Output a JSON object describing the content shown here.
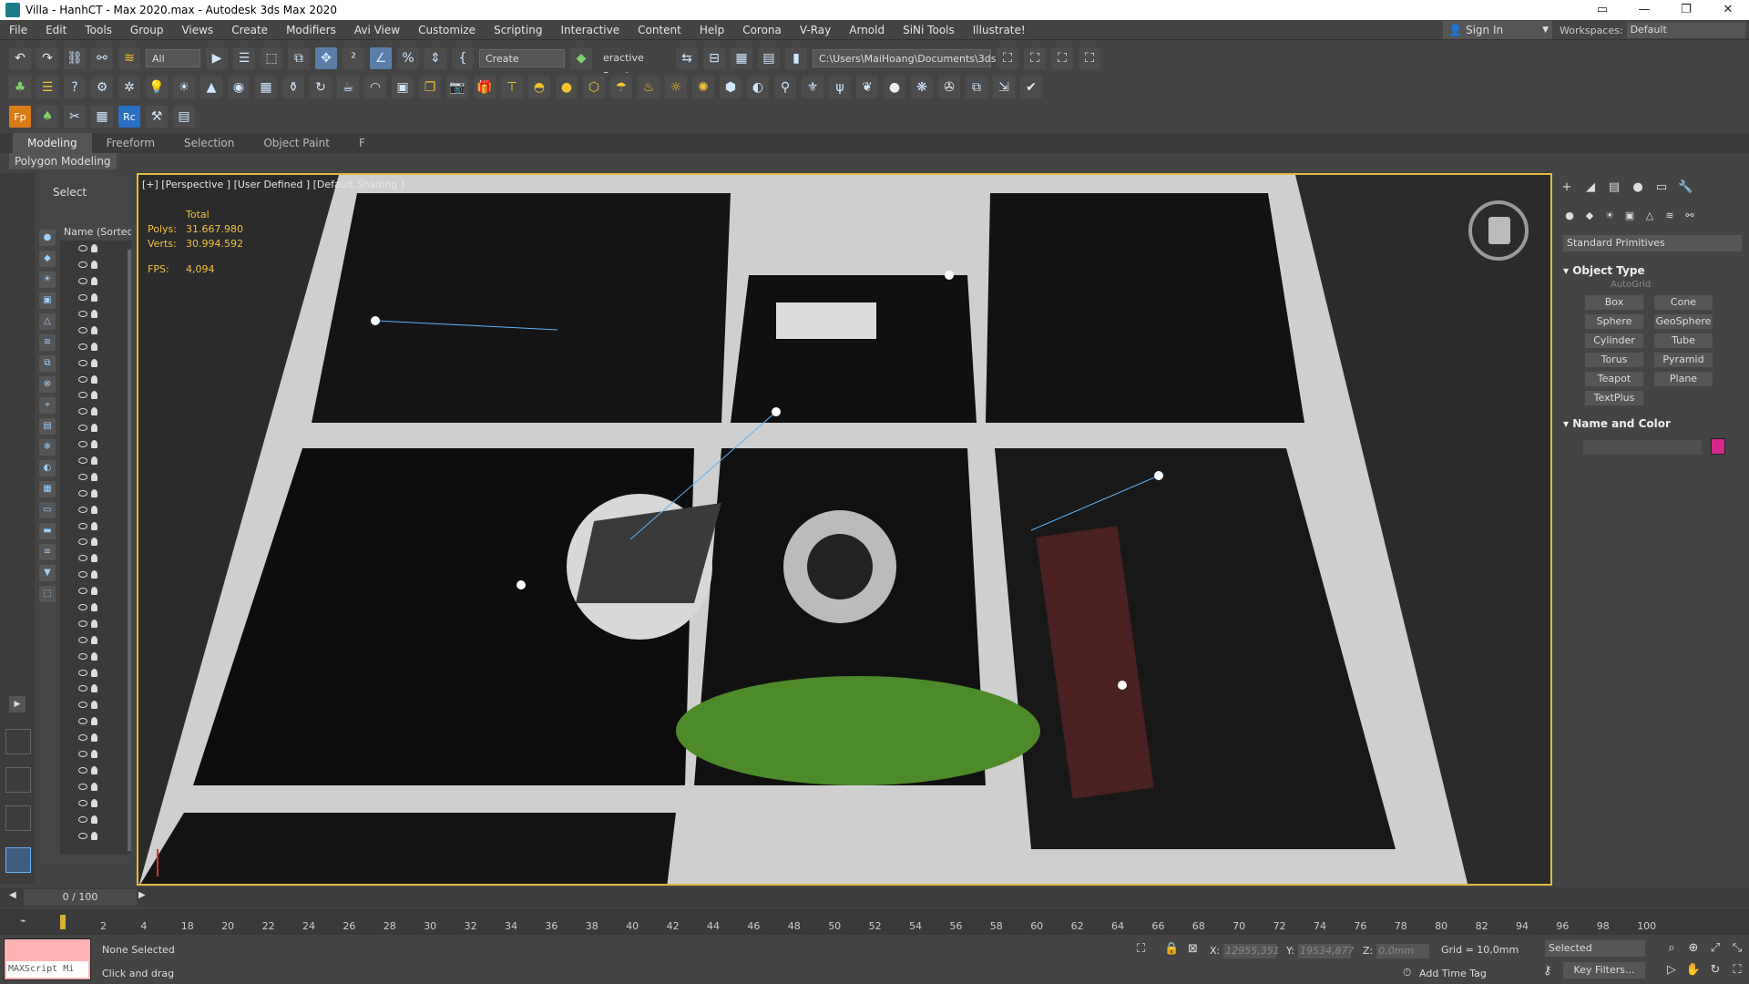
{
  "window": {
    "title": "Villa - HanhCT - Max 2020.max - Autodesk 3ds Max 2020",
    "controls": [
      "▭",
      "—",
      "❐",
      "✕"
    ]
  },
  "menu": [
    "File",
    "Edit",
    "Tools",
    "Group",
    "Views",
    "Create",
    "Modifiers",
    "Avi View",
    "Customize",
    "Scripting",
    "Interactive",
    "Content",
    "Help",
    "Corona",
    "V-Ray",
    "Arnold",
    "SiNi Tools",
    "Illustrate!"
  ],
  "signin": {
    "label": "Sign In"
  },
  "workspaces": {
    "label": "Workspaces:",
    "value": "Default"
  },
  "toolbar": {
    "filter": "All",
    "selection_set": "Create Selection Se",
    "interactive_render": "eractive Rend",
    "path": "C:\\Users\\MaiHoang\\Documents\\3ds Max 2020"
  },
  "ribbon": {
    "tabs": [
      "Modeling",
      "Freeform",
      "Selection",
      "Object Paint",
      "F"
    ],
    "subtitle": "Polygon Modeling"
  },
  "scene_explorer": {
    "title": "Select",
    "column_header": "Name (Sorted A"
  },
  "viewport": {
    "label": "[+] [Perspective ] [User Defined ] [Default Shading ]",
    "stats": {
      "total_label": "Total",
      "polys_label": "Polys:",
      "polys": "31.667.980",
      "verts_label": "Verts:",
      "verts": "30.994.592",
      "fps_label": "FPS:",
      "fps": "4,094"
    }
  },
  "command_panel": {
    "category": "Standard Primitives",
    "object_type_title": "Object Type",
    "autogrid": "AutoGrid",
    "primitives": [
      "Box",
      "Cone",
      "Sphere",
      "GeoSphere",
      "Cylinder",
      "Tube",
      "Torus",
      "Pyramid",
      "Teapot",
      "Plane",
      "TextPlus"
    ],
    "name_color_title": "Name and Color",
    "color": "#d6288a"
  },
  "timeline": {
    "frame_display": "0 / 100",
    "ticks": [
      "2",
      "4",
      "18",
      "20",
      "22",
      "24",
      "26",
      "28",
      "30",
      "32",
      "34",
      "36",
      "38",
      "40",
      "42",
      "44",
      "46",
      "48",
      "50",
      "52",
      "54",
      "56",
      "58",
      "60",
      "62",
      "64",
      "66",
      "68",
      "70",
      "72",
      "74",
      "76",
      "78",
      "80",
      "82",
      "94",
      "96",
      "98",
      "100"
    ]
  },
  "status": {
    "maxscript_placeholder": "MAXScript Mi",
    "selection": "None Selected",
    "hint": "Click and drag",
    "x_label": "X:",
    "x": "12955,351",
    "y_label": "Y:",
    "y": "19534,877",
    "z_label": "Z:",
    "z": "0,0mm",
    "grid": "Grid = 10,0mm",
    "selected_mode": "Selected",
    "key_filters": "Key Filters...",
    "add_time_tag": "Add Time Tag"
  }
}
